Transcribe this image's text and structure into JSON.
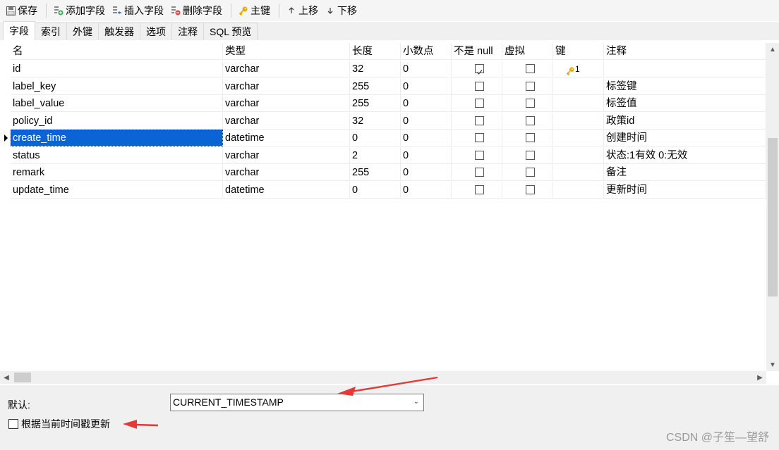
{
  "toolbar": {
    "save": "保存",
    "add_field": "添加字段",
    "insert_field": "插入字段",
    "delete_field": "删除字段",
    "primary_key": "主键",
    "move_up": "上移",
    "move_down": "下移"
  },
  "tabs": [
    {
      "label": "字段",
      "active": true
    },
    {
      "label": "索引"
    },
    {
      "label": "外键"
    },
    {
      "label": "触发器"
    },
    {
      "label": "选项"
    },
    {
      "label": "注释"
    },
    {
      "label": "SQL 预览"
    }
  ],
  "grid": {
    "headers": {
      "name": "名",
      "type": "类型",
      "length": "长度",
      "decimals": "小数点",
      "not_null": "不是 null",
      "virtual": "虚拟",
      "key": "键",
      "comment": "注释"
    },
    "rows": [
      {
        "name": "id",
        "type": "varchar",
        "length": "32",
        "decimals": "0",
        "not_null": true,
        "virtual": false,
        "key": "1",
        "comment": ""
      },
      {
        "name": "label_key",
        "type": "varchar",
        "length": "255",
        "decimals": "0",
        "not_null": false,
        "virtual": false,
        "key": "",
        "comment": "标签键"
      },
      {
        "name": "label_value",
        "type": "varchar",
        "length": "255",
        "decimals": "0",
        "not_null": false,
        "virtual": false,
        "key": "",
        "comment": "标签值"
      },
      {
        "name": "policy_id",
        "type": "varchar",
        "length": "32",
        "decimals": "0",
        "not_null": false,
        "virtual": false,
        "key": "",
        "comment": "政策id"
      },
      {
        "name": "create_time",
        "type": "datetime",
        "length": "0",
        "decimals": "0",
        "not_null": false,
        "virtual": false,
        "key": "",
        "comment": "创建时间",
        "selected": true
      },
      {
        "name": "status",
        "type": "varchar",
        "length": "2",
        "decimals": "0",
        "not_null": false,
        "virtual": false,
        "key": "",
        "comment": "状态:1有效 0:无效"
      },
      {
        "name": "remark",
        "type": "varchar",
        "length": "255",
        "decimals": "0",
        "not_null": false,
        "virtual": false,
        "key": "",
        "comment": "备注"
      },
      {
        "name": "update_time",
        "type": "datetime",
        "length": "0",
        "decimals": "0",
        "not_null": false,
        "virtual": false,
        "key": "",
        "comment": "更新时间"
      }
    ]
  },
  "bottom": {
    "default_label": "默认:",
    "default_value": "CURRENT_TIMESTAMP",
    "update_on_timestamp_label": "根据当前时间戳更新",
    "update_on_timestamp_checked": false
  },
  "watermark": "CSDN @子笙—望舒",
  "colors": {
    "selection": "#0a64d6",
    "key_icon": "#e0a000",
    "annotation_arrow": "#e53935"
  }
}
